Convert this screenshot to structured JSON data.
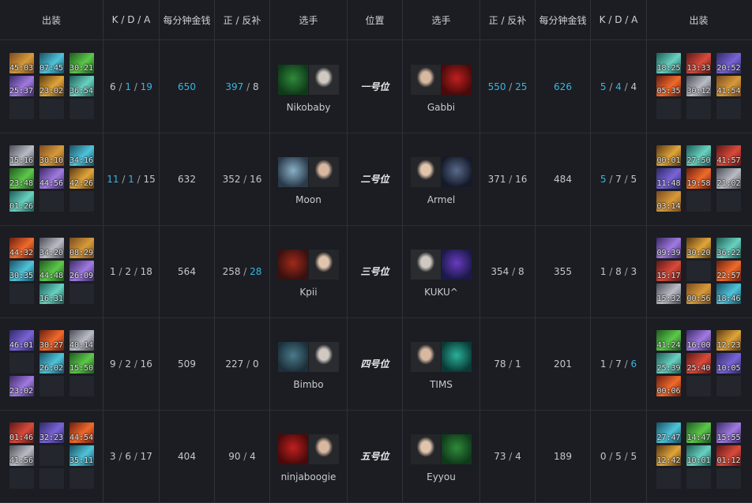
{
  "headers": {
    "items_left": "出装",
    "kda_left": "K / D / A",
    "gpm_left": "每分钟金钱",
    "lh_left": "正 / 反补",
    "player_left": "选手",
    "position": "位置",
    "player_right": "选手",
    "lh_right": "正 / 反补",
    "gpm_right": "每分钟金钱",
    "kda_right": "K / D / A",
    "items_right": "出装"
  },
  "colors": {
    "highlight": "#36b6e4",
    "background": "#1b1d22"
  },
  "rows": [
    {
      "position": "一号位",
      "left": {
        "items": [
          "45:03",
          "07:45",
          "30:21",
          "25:37",
          "23:02",
          "36:54",
          "",
          "",
          ""
        ],
        "kda": [
          "6",
          "1",
          "19"
        ],
        "kda_hl": [
          false,
          true,
          true
        ],
        "gpm": "650",
        "gpm_hl": true,
        "lh": [
          "397",
          "8"
        ],
        "lh_hl": [
          true,
          false
        ],
        "player": "Nikobaby"
      },
      "right": {
        "player": "Gabbi",
        "lh": [
          "550",
          "25"
        ],
        "lh_hl": [
          true,
          true
        ],
        "gpm": "626",
        "gpm_hl": true,
        "kda": [
          "5",
          "4",
          "4"
        ],
        "kda_hl": [
          true,
          true,
          false
        ],
        "items": [
          "18:25",
          "13:33",
          "20:52",
          "05:35",
          "30:12",
          "41:54",
          "",
          "",
          ""
        ]
      }
    },
    {
      "position": "二号位",
      "left": {
        "items": [
          "15:16",
          "30:10",
          "34:16",
          "23:48",
          "44:56",
          "42:26",
          "01:26",
          "",
          ""
        ],
        "kda": [
          "11",
          "1",
          "15"
        ],
        "kda_hl": [
          true,
          true,
          false
        ],
        "gpm": "632",
        "gpm_hl": false,
        "lh": [
          "352",
          "16"
        ],
        "lh_hl": [
          false,
          false
        ],
        "player": "Moon"
      },
      "right": {
        "player": "Armel",
        "lh": [
          "371",
          "16"
        ],
        "lh_hl": [
          false,
          false
        ],
        "gpm": "484",
        "gpm_hl": false,
        "kda": [
          "5",
          "7",
          "5"
        ],
        "kda_hl": [
          true,
          false,
          false
        ],
        "items": [
          "00:01",
          "27:50",
          "41:57",
          "11:48",
          "19:58",
          "21:02",
          "03:14",
          "",
          ""
        ]
      }
    },
    {
      "position": "三号位",
      "left": {
        "items": [
          "44:32",
          "34:20",
          "08:29",
          "30:35",
          "44:48",
          "26:09",
          "",
          "16:31",
          ""
        ],
        "kda": [
          "1",
          "2",
          "18"
        ],
        "kda_hl": [
          false,
          false,
          false
        ],
        "gpm": "564",
        "gpm_hl": false,
        "lh": [
          "258",
          "28"
        ],
        "lh_hl": [
          false,
          true
        ],
        "player": "Kpii"
      },
      "right": {
        "player": "KUKU^",
        "lh": [
          "354",
          "8"
        ],
        "lh_hl": [
          false,
          false
        ],
        "gpm": "355",
        "gpm_hl": false,
        "kda": [
          "1",
          "8",
          "3"
        ],
        "kda_hl": [
          false,
          false,
          false
        ],
        "items": [
          "09:39",
          "30:20",
          "36:22",
          "15:17",
          "",
          "22:57",
          "15:32",
          "00:56",
          "18:46"
        ]
      }
    },
    {
      "position": "四号位",
      "left": {
        "items": [
          "46:01",
          "30:27",
          "40:14",
          "",
          "26:02",
          "15:50",
          "23:02",
          "",
          ""
        ],
        "kda": [
          "9",
          "2",
          "16"
        ],
        "kda_hl": [
          false,
          false,
          false
        ],
        "gpm": "509",
        "gpm_hl": false,
        "lh": [
          "227",
          "0"
        ],
        "lh_hl": [
          false,
          false
        ],
        "player": "Bimbo"
      },
      "right": {
        "player": "TIMS",
        "lh": [
          "78",
          "1"
        ],
        "lh_hl": [
          false,
          false
        ],
        "gpm": "201",
        "gpm_hl": false,
        "kda": [
          "1",
          "7",
          "6"
        ],
        "kda_hl": [
          false,
          false,
          true
        ],
        "items": [
          "41:24",
          "16:00",
          "12:23",
          "25:39",
          "25:40",
          "10:05",
          "00:06",
          "",
          ""
        ]
      }
    },
    {
      "position": "五号位",
      "left": {
        "items": [
          "01:46",
          "32:23",
          "44:54",
          "41:56",
          "",
          "35:11",
          "",
          "",
          ""
        ],
        "kda": [
          "3",
          "6",
          "17"
        ],
        "kda_hl": [
          false,
          false,
          false
        ],
        "gpm": "404",
        "gpm_hl": false,
        "lh": [
          "90",
          "4"
        ],
        "lh_hl": [
          false,
          false
        ],
        "player": "ninjaboogie"
      },
      "right": {
        "player": "Eyyou",
        "lh": [
          "73",
          "4"
        ],
        "lh_hl": [
          false,
          false
        ],
        "gpm": "189",
        "gpm_hl": false,
        "kda": [
          "0",
          "5",
          "5"
        ],
        "kda_hl": [
          false,
          false,
          false
        ],
        "items": [
          "27:47",
          "14:47",
          "15:55",
          "12:42",
          "10:01",
          "01:12",
          "",
          "",
          ""
        ]
      }
    }
  ]
}
